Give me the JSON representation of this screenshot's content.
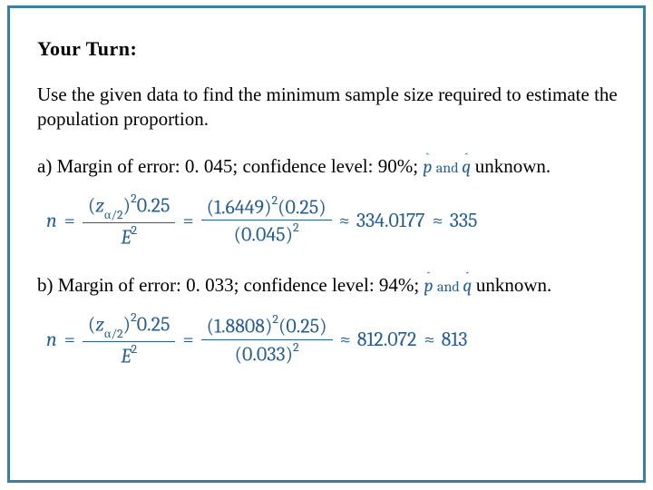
{
  "title": "Your Turn:",
  "prompt": "Use the given data to find the minimum sample size required to estimate the population proportion.",
  "parts": {
    "a": {
      "label": "a)",
      "text_before_pq": "a) Margin of error: 0. 045; confidence level: 90%; ",
      "pq_phrase": " and ",
      "text_after_pq": " unknown.",
      "formula_numerator": "0.25",
      "formula_z_sub": "α/2",
      "z_value": "1.6449",
      "product": "0.25",
      "E_value": "0.045",
      "approx1": "334.0177",
      "approx2": "335"
    },
    "b": {
      "label": "b)",
      "text_before_pq": "b) Margin of error: 0. 033; confidence level: 94%; ",
      "pq_phrase": " and ",
      "text_after_pq": " unknown.",
      "formula_numerator": "0.25",
      "formula_z_sub": "α/2",
      "z_value": "1.8808",
      "product": "0.25",
      "E_value": "0.033",
      "approx1": "812.072",
      "approx2": "813"
    }
  },
  "symbols": {
    "n": "n",
    "eq": "=",
    "approx": "≈",
    "E": "E",
    "z": "z",
    "hat_p": "p",
    "hat_q": "q"
  }
}
